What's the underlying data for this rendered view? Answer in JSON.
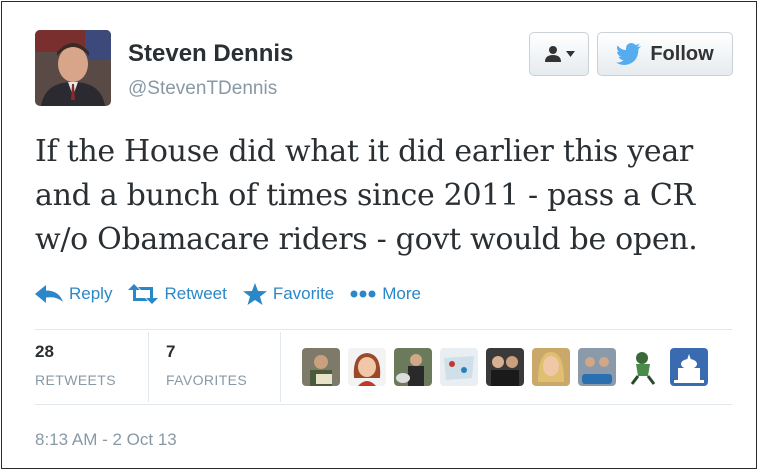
{
  "header": {
    "display_name": "Steven Dennis",
    "handle": "@StevenTDennis",
    "follow_label": "Follow"
  },
  "tweet": {
    "lines": [
      "If the House did what it did earlier this year",
      "and a bunch of times since 2011 - pass a CR",
      "w/o Obamacare riders - govt would be open."
    ]
  },
  "actions": {
    "reply": "Reply",
    "retweet": "Retweet",
    "favorite": "Favorite",
    "more": "More"
  },
  "stats": {
    "retweets_count": "28",
    "retweets_label": "RETWEETS",
    "favorites_count": "7",
    "favorites_label": "FAVORITES"
  },
  "favoriters": [
    {
      "icon": "avatar-man-sign"
    },
    {
      "icon": "avatar-cartoon-woman"
    },
    {
      "icon": "avatar-man-dog"
    },
    {
      "icon": "avatar-map"
    },
    {
      "icon": "avatar-couple"
    },
    {
      "icon": "avatar-blonde-woman"
    },
    {
      "icon": "avatar-group-badge"
    },
    {
      "icon": "avatar-cartoon-runner"
    },
    {
      "icon": "avatar-capitol"
    }
  ],
  "timestamp": "8:13 AM - 2 Oct 13",
  "colors": {
    "link": "#2a87c8",
    "text": "#292f33",
    "muted": "#8899a6",
    "twitter_blue": "#55acee",
    "border": "#2b2b2b"
  }
}
